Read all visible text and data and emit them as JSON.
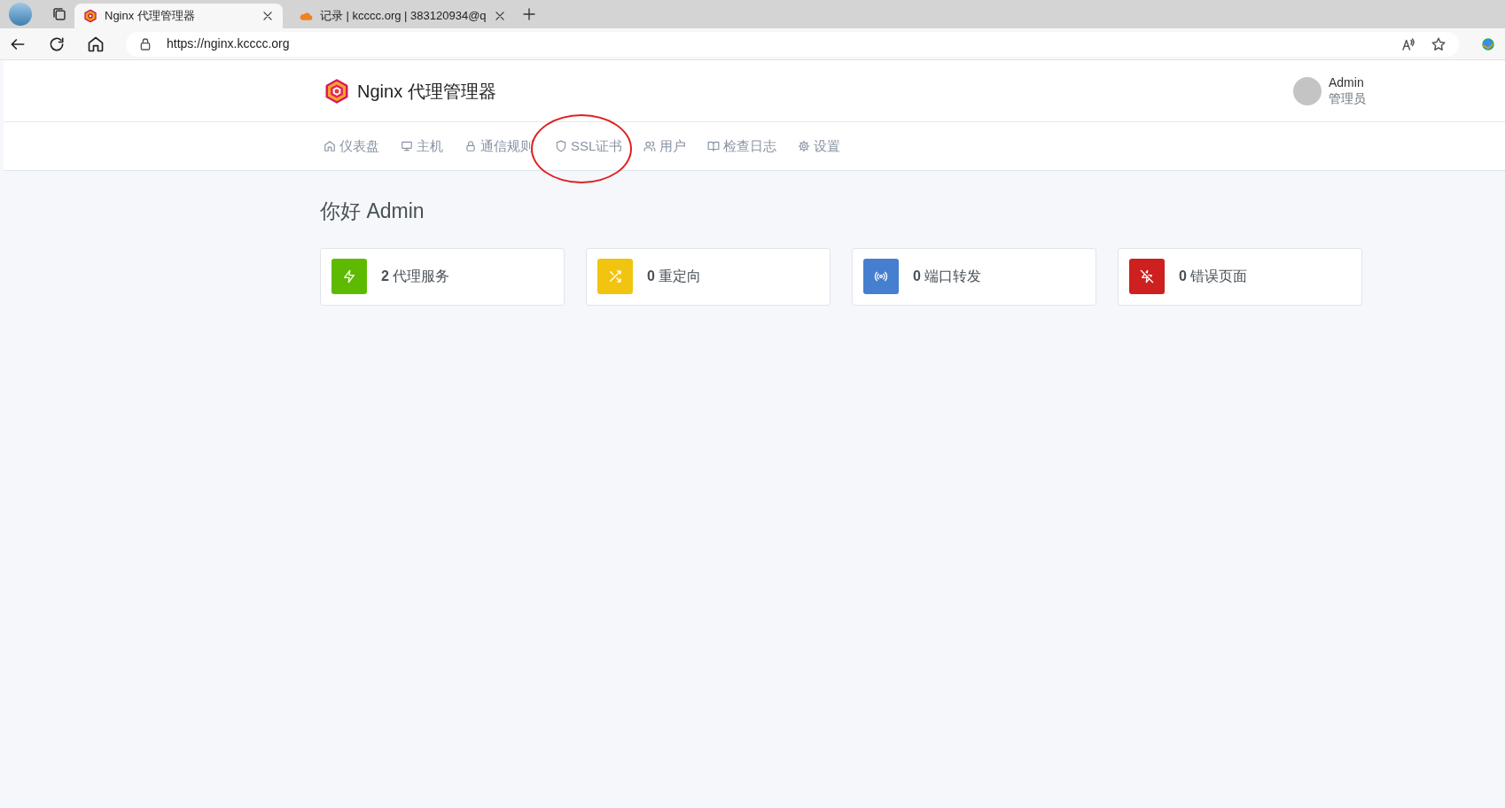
{
  "browser": {
    "tabs": [
      {
        "title": "Nginx 代理管理器",
        "selected": true
      },
      {
        "title": "记录 | kcccc.org | 383120934@q",
        "selected": false
      }
    ],
    "url": "https://nginx.kcccc.org"
  },
  "app": {
    "title": "Nginx 代理管理器",
    "user": {
      "name": "Admin",
      "role": "管理员"
    }
  },
  "nav": [
    {
      "label": "仪表盘"
    },
    {
      "label": "主机"
    },
    {
      "label": "通信规则"
    },
    {
      "label": "SSL证书"
    },
    {
      "label": "用户"
    },
    {
      "label": "检查日志"
    },
    {
      "label": "设置"
    }
  ],
  "greeting": "你好 Admin",
  "stats": [
    {
      "count": "2",
      "label": "代理服务",
      "color": "#5eba00"
    },
    {
      "count": "0",
      "label": "重定向",
      "color": "#f1c40f"
    },
    {
      "count": "0",
      "label": "端口转发",
      "color": "#467fcf"
    },
    {
      "count": "0",
      "label": "错误页面",
      "color": "#cd201f"
    }
  ]
}
